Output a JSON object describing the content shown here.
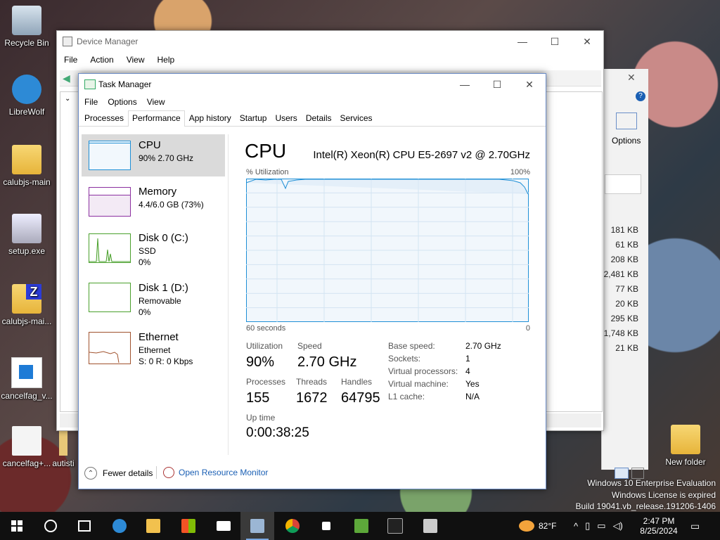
{
  "desktop": {
    "icons": [
      {
        "label": "Recycle Bin"
      },
      {
        "label": "LibreWolf"
      },
      {
        "label": "calubjs-main"
      },
      {
        "label": "setup.exe"
      },
      {
        "label": "calubjs-mai..."
      },
      {
        "label": "cancelfag_v..."
      },
      {
        "label": "cancelfag+..."
      },
      {
        "label": "autisti"
      },
      {
        "label": "New folder"
      }
    ],
    "watermark": {
      "line1": "Windows 10 Enterprise Evaluation",
      "line2": "Windows License is expired",
      "line3": "Build 19041.vb_release.191206-1406"
    }
  },
  "device_manager": {
    "title": "Device Manager",
    "menu": [
      "File",
      "Action",
      "View",
      "Help"
    ],
    "options_label": "Options",
    "sizes": [
      "181 KB",
      "61 KB",
      "208 KB",
      "2,481 KB",
      "77 KB",
      "20 KB",
      "295 KB",
      "1,748 KB",
      "21 KB"
    ]
  },
  "task_manager": {
    "title": "Task Manager",
    "menu": [
      "File",
      "Options",
      "View"
    ],
    "tabs": [
      "Processes",
      "Performance",
      "App history",
      "Startup",
      "Users",
      "Details",
      "Services"
    ],
    "active_tab": "Performance",
    "sidebar": [
      {
        "name": "CPU",
        "line1": "90% 2.70 GHz",
        "line2": ""
      },
      {
        "name": "Memory",
        "line1": "4.4/6.0 GB (73%)",
        "line2": ""
      },
      {
        "name": "Disk 0 (C:)",
        "line1": "SSD",
        "line2": "0%"
      },
      {
        "name": "Disk 1 (D:)",
        "line1": "Removable",
        "line2": "0%"
      },
      {
        "name": "Ethernet",
        "line1": "Ethernet",
        "line2": "S: 0 R: 0 Kbps"
      }
    ],
    "detail": {
      "heading": "CPU",
      "model": "Intel(R) Xeon(R) CPU E5-2697 v2 @ 2.70GHz",
      "graph_top_left": "% Utilization",
      "graph_top_right": "100%",
      "graph_bottom_left": "60 seconds",
      "graph_bottom_right": "0",
      "utilization_label": "Utilization",
      "utilization_value": "90%",
      "speed_label": "Speed",
      "speed_value": "2.70 GHz",
      "processes_label": "Processes",
      "processes_value": "155",
      "threads_label": "Threads",
      "threads_value": "1672",
      "handles_label": "Handles",
      "handles_value": "64795",
      "uptime_label": "Up time",
      "uptime_value": "0:00:38:25",
      "specs": [
        {
          "label": "Base speed:",
          "value": "2.70 GHz"
        },
        {
          "label": "Sockets:",
          "value": "1"
        },
        {
          "label": "Virtual processors:",
          "value": "4"
        },
        {
          "label": "Virtual machine:",
          "value": "Yes"
        },
        {
          "label": "L1 cache:",
          "value": "N/A"
        }
      ]
    },
    "footer": {
      "fewer_details": "Fewer details",
      "resource_monitor": "Open Resource Monitor"
    }
  },
  "taskbar": {
    "weather": "82°F",
    "time": "2:47 PM",
    "date": "8/25/2024"
  },
  "colors": {
    "cpu_graph": "#1e8fd6",
    "memory_graph": "#8b2fa0",
    "disk_graph": "#4aa02c",
    "ethernet_graph": "#a0522d",
    "accent": "#1a5fb4"
  }
}
